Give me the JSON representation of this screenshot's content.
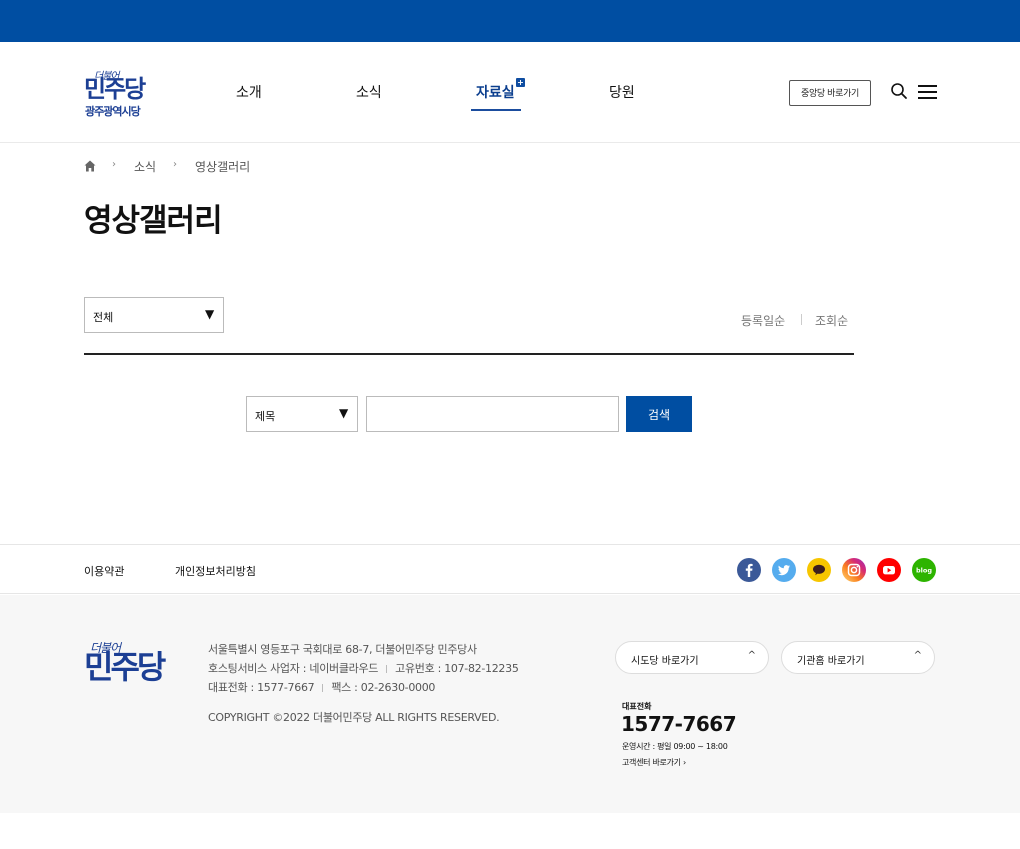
{
  "header": {
    "logo": {
      "script": "더불어",
      "main": "민주당",
      "sub": "광주광역시당"
    },
    "nav": [
      {
        "label": "소개"
      },
      {
        "label": "소식"
      },
      {
        "label": "자료실",
        "badge": "+"
      },
      {
        "label": "당원"
      }
    ],
    "central_link": "중앙당 바로가기",
    "search_icon": "search-icon",
    "menu_icon": "hamburger-menu-icon"
  },
  "breadcrumb": {
    "home_icon": "home-icon",
    "separator": "›",
    "items": [
      "소식",
      "영상갤러리"
    ]
  },
  "page_title": "영상갤러리",
  "filter": {
    "category_value": "전체",
    "caret": "▼"
  },
  "sort": {
    "by_date": "등록일순",
    "by_views": "조회순"
  },
  "search": {
    "field_value": "제목",
    "caret": "▼",
    "input_value": "",
    "button_label": "검색"
  },
  "footer_links": {
    "terms": "이용약관",
    "privacy": "개인정보처리방침"
  },
  "sns": [
    {
      "icon": "facebook-icon",
      "color": "#3b5998"
    },
    {
      "icon": "twitter-icon",
      "color": "#55acee"
    },
    {
      "icon": "kakaotalk-icon",
      "color": "#f7c600"
    },
    {
      "icon": "instagram-icon",
      "color": "#d62976"
    },
    {
      "icon": "youtube-icon",
      "color": "#ff0000"
    },
    {
      "icon": "blog-icon",
      "color": "#2db400",
      "text": "blog"
    }
  ],
  "footer": {
    "logo": {
      "script": "더불어",
      "main": "민주당"
    },
    "address": "서울특별시 영등포구 국회대로 68-7, 더불어민주당 민주당사",
    "hosting": "호스팅서비스 사업자 : 네이버클라우드",
    "business_no": "고유번호 : 107-82-12235",
    "tel": "대표전화 : 1577-7667",
    "fax": "팩스 : 02-2630-0000",
    "copyright": "COPYRIGHT ©2022 더불어민주당 ALL RIGHTS RESERVED.",
    "dropdowns": {
      "local_party": "시도당 바로가기",
      "agencies": "기관홈 바로가기",
      "chevron": "^"
    },
    "callcenter": {
      "label": "대표전화",
      "number": "1577-7667",
      "hours": "운영시간 : 평일 09:00 ~ 18:00",
      "link": "고객센터 바로가기 ›"
    }
  },
  "colors": {
    "brand_blue": "#004ea2",
    "logo_navy": "#1c3f94"
  }
}
